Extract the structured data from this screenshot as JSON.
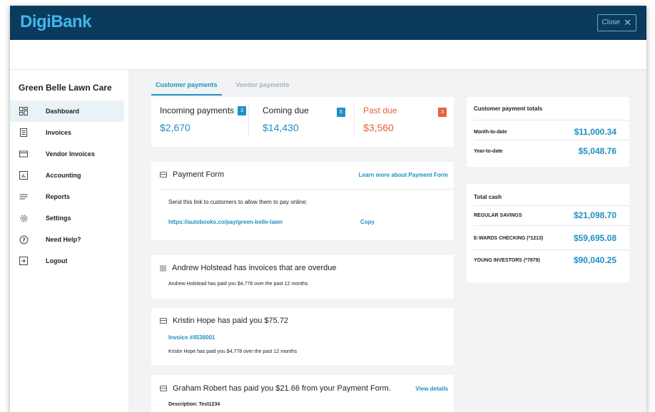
{
  "app": {
    "logo": "DigiBank",
    "close_label": "Close"
  },
  "sidebar": {
    "company": "Green Belle Lawn Care",
    "items": [
      {
        "label": "Dashboard",
        "icon": "dashboard-icon",
        "active": true
      },
      {
        "label": "Invoices",
        "icon": "invoice-icon"
      },
      {
        "label": "Vendor Invoices",
        "icon": "card-icon"
      },
      {
        "label": "Accounting",
        "icon": "chart-icon"
      },
      {
        "label": "Reports",
        "icon": "menu-icon"
      },
      {
        "label": "Settings",
        "icon": "gear-icon"
      },
      {
        "label": "Need Help?",
        "icon": "help-icon"
      },
      {
        "label": "Logout",
        "icon": "logout-icon"
      }
    ]
  },
  "tabs": [
    {
      "label": "Customer payments",
      "active": true
    },
    {
      "label": "Vendor payments",
      "active": false
    }
  ],
  "summary": {
    "incoming": {
      "label": "Incoming payments",
      "badge": "3",
      "amount": "$2,670",
      "color": "#1f90c2"
    },
    "coming_due": {
      "label": "Coming due",
      "badge": "5",
      "amount": "$14,430",
      "color": "#1f90c2"
    },
    "past_due": {
      "label": "Past due",
      "badge": "3",
      "amount": "$3,560",
      "color": "#e8603c"
    }
  },
  "payment_form": {
    "title": "Payment Form",
    "learn_more": "Learn more about Payment Form",
    "instruction": "Send this link to customers to allow them to pay online:",
    "url": "https://autobooks.co/pay/green-belle-lawn",
    "copy_label": "Copy"
  },
  "activity": [
    {
      "title": "Andrew Holstead has invoices that are overdue",
      "detail": "Andrew Holstead has paid you $4,778 over the past 12 months"
    },
    {
      "title": "Kristin Hope has paid you $75.72",
      "invoice": "Invoice #4536001",
      "detail": "Kristin Hope has paid you $4,778 over the past 12 months"
    },
    {
      "title": "Graham Robert has paid you $21.66 from your Payment Form.",
      "view_details": "View details",
      "description": "Description: Test1234"
    }
  ],
  "payment_totals": {
    "title": "Customer payment totals",
    "rows": [
      {
        "label": "Month-to-date",
        "value": "$11,000.34"
      },
      {
        "label": "Year-to-date",
        "value": "$5,048.76"
      }
    ]
  },
  "total_cash": {
    "title": "Total cash",
    "rows": [
      {
        "label": "REGULAR SAVINGS",
        "value": "$21,098.70"
      },
      {
        "label": "E-WARDS CHECKING (*1213)",
        "value": "$59,695.08"
      },
      {
        "label": "YOUNG INVESTORS (*7879)",
        "value": "$90,040.25"
      }
    ]
  }
}
